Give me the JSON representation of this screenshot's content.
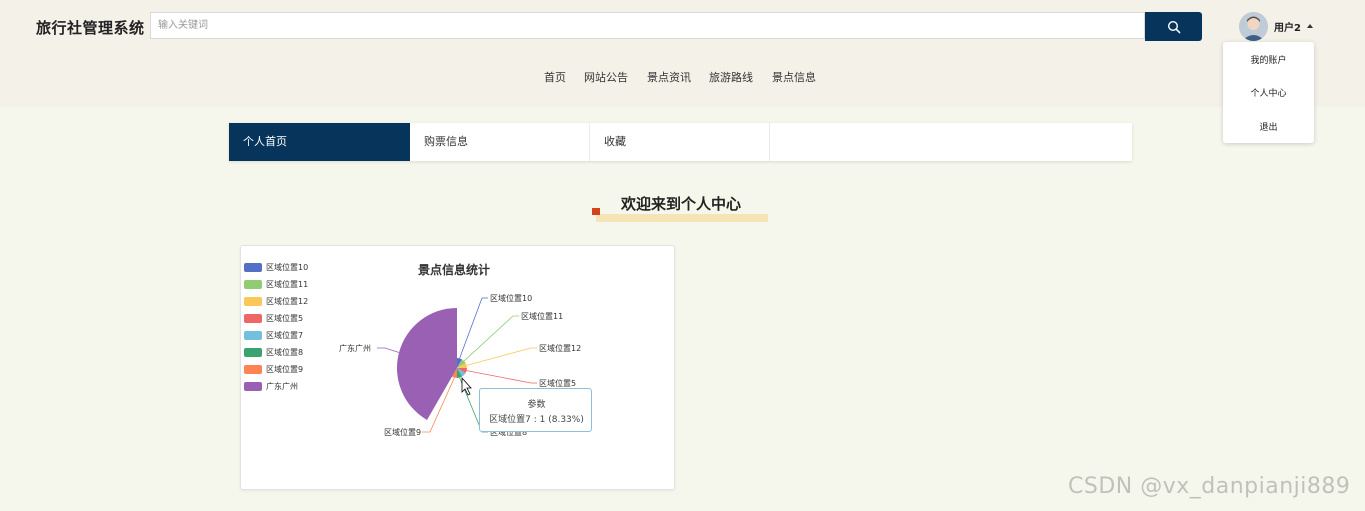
{
  "header": {
    "app_title": "旅行社管理系统",
    "search_placeholder": "输入关键词",
    "username": "用户2"
  },
  "user_menu": {
    "items": [
      "我的账户",
      "个人中心",
      "退出"
    ]
  },
  "nav": {
    "items": [
      "首页",
      "网站公告",
      "景点资讯",
      "旅游路线",
      "景点信息"
    ]
  },
  "tabs": {
    "items": [
      "个人首页",
      "购票信息",
      "收藏"
    ],
    "active_index": 0
  },
  "welcome_title": "欢迎来到个人中心",
  "colors": {
    "primary": "#06345a",
    "background": "#f6f7ec",
    "accent_red": "#d6431a",
    "accent_yellow": "#f5e4b5"
  },
  "chart_data": {
    "type": "pie",
    "title": "景点信息统计",
    "series_name": "参数",
    "legend_position": "top-left",
    "slices": [
      {
        "name": "区域位置10",
        "value": 1,
        "color": "#5470c6"
      },
      {
        "name": "区域位置11",
        "value": 1,
        "color": "#91cc75"
      },
      {
        "name": "区域位置12",
        "value": 1,
        "color": "#fac858"
      },
      {
        "name": "区域位置5",
        "value": 1,
        "color": "#ee6666"
      },
      {
        "name": "区域位置7",
        "value": 1,
        "color": "#73c0de"
      },
      {
        "name": "区域位置8",
        "value": 1,
        "color": "#3ba272"
      },
      {
        "name": "区域位置9",
        "value": 1,
        "color": "#fc8452"
      },
      {
        "name": "广东广州",
        "value": 5,
        "color": "#9a60b4"
      }
    ],
    "outer_labels": [
      "区域位置10",
      "区域位置11",
      "区域位置12",
      "区域位置5",
      "区域位置8",
      "区域位置9",
      "广东广州"
    ],
    "tooltip": {
      "title": "参数",
      "text": "区域位置7 : 1 (8.33%)"
    }
  },
  "watermark": "CSDN @vx_danpianji889"
}
